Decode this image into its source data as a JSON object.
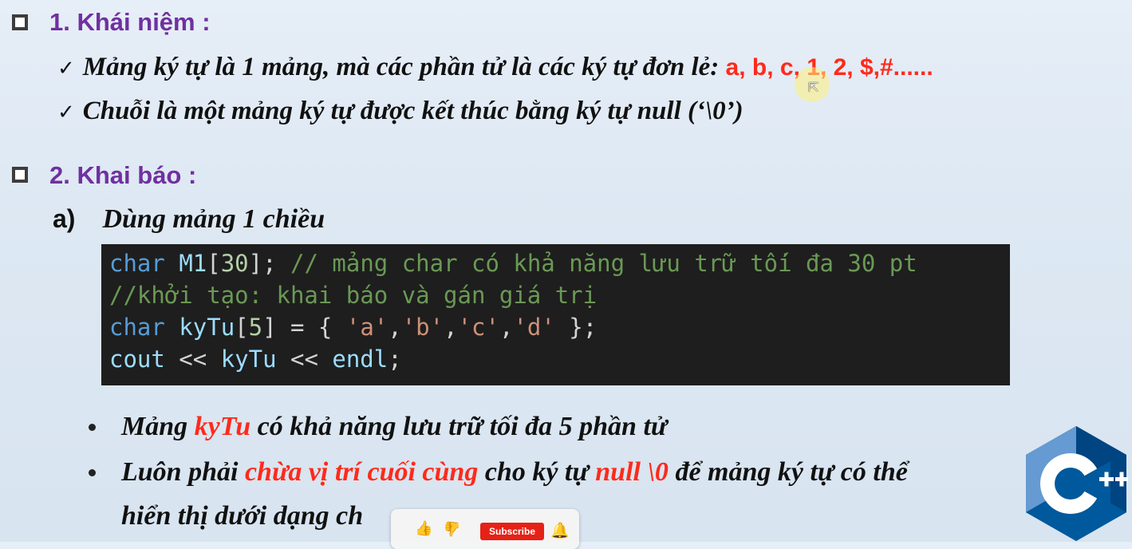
{
  "section1": {
    "title": "1. Khái niệm :"
  },
  "concepts": [
    {
      "text": "Mảng ký tự là 1 mảng, mà các phần tử là các ký tự đơn lẻ: ",
      "examples": "a, b, c, 1, 2, $,#......"
    },
    {
      "text": "Chuỗi là một mảng ký tự được kết thúc bằng ký tự null (‘\\0’)"
    }
  ],
  "section2": {
    "title": "2. Khai báo :"
  },
  "subsection": {
    "label": "a)",
    "title": "Dùng mảng 1 chiều"
  },
  "code_lines": [
    "char M1[30]; // mảng char có khả năng lưu trữ tối đa 30 pt",
    "//khởi tạo: khai báo và gán giá trị",
    "char kyTu[5] = { 'a','b','c','d' };",
    "cout << kyTu << endl;"
  ],
  "notes": [
    {
      "pre": "Mảng ",
      "highlight": "kyTu",
      "post": " có khả năng lưu trữ tối đa 5 phần tử"
    },
    {
      "pre": "Luôn phải ",
      "highlight": "chừa vị trí cuối cùng",
      "mid": " cho ký tự ",
      "highlight2": "null \\0",
      "post": " để mảng ký tự có thể",
      "line2": "hiển thị dưới dạng ch"
    }
  ],
  "overlay": {
    "subscribe_label": "Subscribe"
  },
  "logo": {
    "text": "C++",
    "color": "#00599c"
  },
  "colors": {
    "heading": "#7030a0",
    "highlight": "#ff2a1a",
    "code_bg": "#1e1e1e"
  }
}
